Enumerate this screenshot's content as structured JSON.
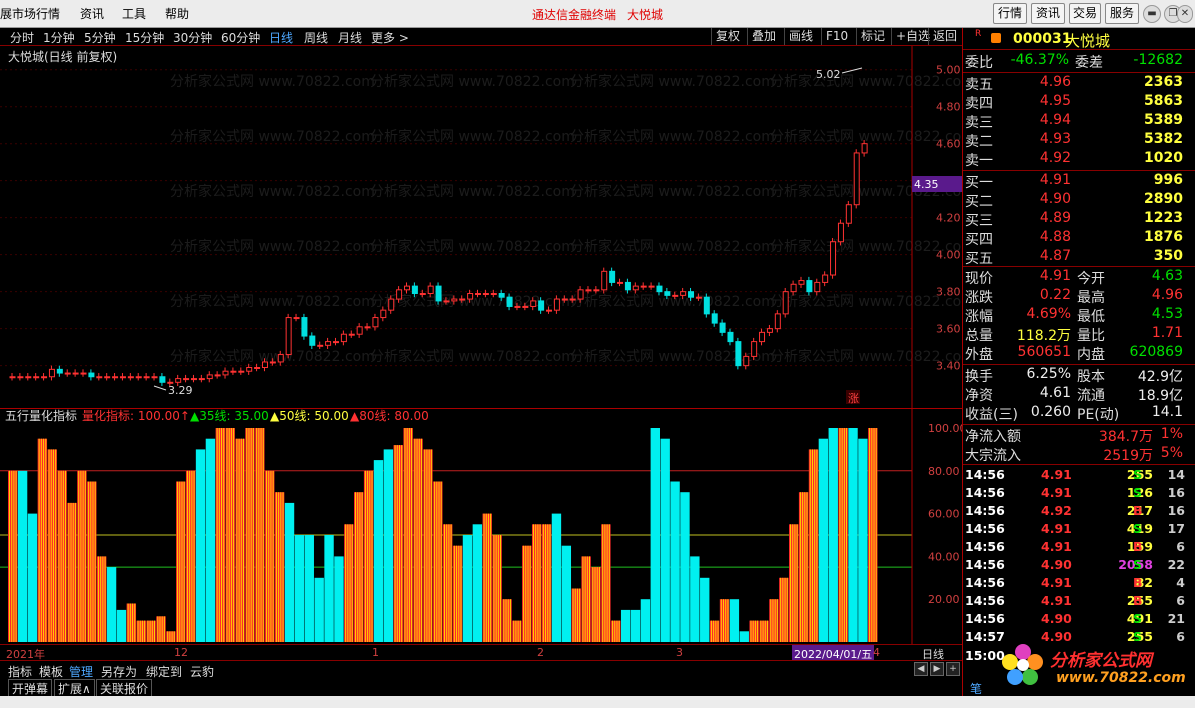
{
  "menu": {
    "items": [
      "展市场行情",
      "资讯",
      "工具",
      "帮助"
    ],
    "title": "通达信金融终端",
    "stock_name": "大悦城",
    "right_buttons": [
      "行情",
      "资讯",
      "交易",
      "服务"
    ]
  },
  "toolbar": {
    "periods": [
      "分时",
      "1分钟",
      "5分钟",
      "15分钟",
      "30分钟",
      "60分钟",
      "日线",
      "周线",
      "月线",
      "更多 >"
    ],
    "active_period": "日线",
    "buttons": [
      "复权",
      "叠加",
      "画线",
      "F10",
      "标记",
      "+自选",
      "返回"
    ]
  },
  "chart_header": "大悦城(日线 前复权)",
  "price_axis": [
    "5.00",
    "4.80",
    "4.60",
    "4.35",
    "4.20",
    "4.00",
    "3.80",
    "3.60",
    "3.40"
  ],
  "current_price_tag": "4.35",
  "annotations": {
    "high": "5.02",
    "low": "3.29",
    "zhang": "涨"
  },
  "indicator": {
    "name": "五行量化指标",
    "labels": [
      {
        "text": "量化指标: 100.00↑",
        "color": "#ff3232"
      },
      {
        "text": "▲35线: 35.00",
        "color": "#00e000"
      },
      {
        "text": "▲50线: 50.00",
        "color": "#ffff40"
      },
      {
        "text": "▲80线: 80.00",
        "color": "#ff3232"
      }
    ],
    "axis": [
      "100.00",
      "80.00",
      "60.00",
      "40.00",
      "20.00"
    ]
  },
  "date_axis": {
    "labels": [
      "2021年",
      "12",
      "1",
      "2",
      "3"
    ],
    "cursor_date": "2022/04/01/五",
    "cursor_suffix": "4",
    "period_label": "日线"
  },
  "bottom_tabs": [
    "指标",
    "模板",
    "管理",
    "另存为",
    "绑定到",
    "云豹"
  ],
  "bottom_tabs2": [
    "开弹幕",
    "扩展∧",
    "关联报价"
  ],
  "quote": {
    "code": "000031",
    "name": "大悦城",
    "wei_bi_label": "委比",
    "wei_bi": "-46.37%",
    "wei_cha_label": "委差",
    "wei_cha": "-12682",
    "asks": [
      {
        "label": "卖五",
        "price": "4.96",
        "vol": "2363"
      },
      {
        "label": "卖四",
        "price": "4.95",
        "vol": "5863"
      },
      {
        "label": "卖三",
        "price": "4.94",
        "vol": "5389"
      },
      {
        "label": "卖二",
        "price": "4.93",
        "vol": "5382"
      },
      {
        "label": "卖一",
        "price": "4.92",
        "vol": "1020"
      }
    ],
    "bids": [
      {
        "label": "买一",
        "price": "4.91",
        "vol": "996"
      },
      {
        "label": "买二",
        "price": "4.90",
        "vol": "2890"
      },
      {
        "label": "买三",
        "price": "4.89",
        "vol": "1223"
      },
      {
        "label": "买四",
        "price": "4.88",
        "vol": "1876"
      },
      {
        "label": "买五",
        "price": "4.87",
        "vol": "350"
      }
    ],
    "stats": [
      {
        "l1": "现价",
        "v1": "4.91",
        "c1": "red",
        "l2": "今开",
        "v2": "4.63",
        "c2": "green"
      },
      {
        "l1": "涨跌",
        "v1": "0.22",
        "c1": "red",
        "l2": "最高",
        "v2": "4.96",
        "c2": "red"
      },
      {
        "l1": "涨幅",
        "v1": "4.69%",
        "c1": "red",
        "l2": "最低",
        "v2": "4.53",
        "c2": "green"
      },
      {
        "l1": "总量",
        "v1": "118.2万",
        "c1": "yellow",
        "l2": "量比",
        "v2": "1.71",
        "c2": "red"
      },
      {
        "l1": "外盘",
        "v1": "560651",
        "c1": "red",
        "l2": "内盘",
        "v2": "620869",
        "c2": "green"
      }
    ],
    "stats2": [
      {
        "l1": "换手",
        "v1": "6.25%",
        "l2": "股本",
        "v2": "42.9亿"
      },
      {
        "l1": "净资",
        "v1": "4.61",
        "l2": "流通",
        "v2": "18.9亿"
      },
      {
        "l1": "收益(三)",
        "v1": "0.260",
        "l2": "PE(动)",
        "v2": "14.1"
      }
    ],
    "flows": [
      {
        "label": "净流入额",
        "value": "384.7万",
        "pct": "1%"
      },
      {
        "label": "大宗流入",
        "value": "2519万",
        "pct": "5%"
      }
    ],
    "ticks": [
      {
        "time": "14:56",
        "price": "4.91",
        "pc": "red",
        "vol": "265",
        "vc": "yellow",
        "bs": "S",
        "bc": "green",
        "n": "14"
      },
      {
        "time": "14:56",
        "price": "4.91",
        "pc": "red",
        "vol": "126",
        "vc": "yellow",
        "bs": "S",
        "bc": "green",
        "n": "16"
      },
      {
        "time": "14:56",
        "price": "4.92",
        "pc": "red",
        "vol": "217",
        "vc": "yellow",
        "bs": "B",
        "bc": "red",
        "n": "16"
      },
      {
        "time": "14:56",
        "price": "4.91",
        "pc": "red",
        "vol": "419",
        "vc": "yellow",
        "bs": "S",
        "bc": "green",
        "n": "17"
      },
      {
        "time": "14:56",
        "price": "4.91",
        "pc": "red",
        "vol": "159",
        "vc": "yellow",
        "bs": "B",
        "bc": "red",
        "n": "6"
      },
      {
        "time": "14:56",
        "price": "4.90",
        "pc": "red",
        "vol": "2058",
        "vc": "mag",
        "bs": "S",
        "bc": "green",
        "n": "22"
      },
      {
        "time": "14:56",
        "price": "4.91",
        "pc": "red",
        "vol": "82",
        "vc": "yellow",
        "bs": "B",
        "bc": "red",
        "n": "4"
      },
      {
        "time": "14:56",
        "price": "4.91",
        "pc": "red",
        "vol": "255",
        "vc": "yellow",
        "bs": "B",
        "bc": "red",
        "n": "6"
      },
      {
        "time": "14:56",
        "price": "4.90",
        "pc": "red",
        "vol": "491",
        "vc": "yellow",
        "bs": "S",
        "bc": "green",
        "n": "21"
      },
      {
        "time": "14:57",
        "price": "4.90",
        "pc": "red",
        "vol": "255",
        "vc": "yellow",
        "bs": "S",
        "bc": "green",
        "n": "6"
      }
    ],
    "last_time": "15:00",
    "bottom_tab": "笔"
  },
  "watermark": {
    "brand": "分析家公式网",
    "url": "www.70822.com"
  }
}
